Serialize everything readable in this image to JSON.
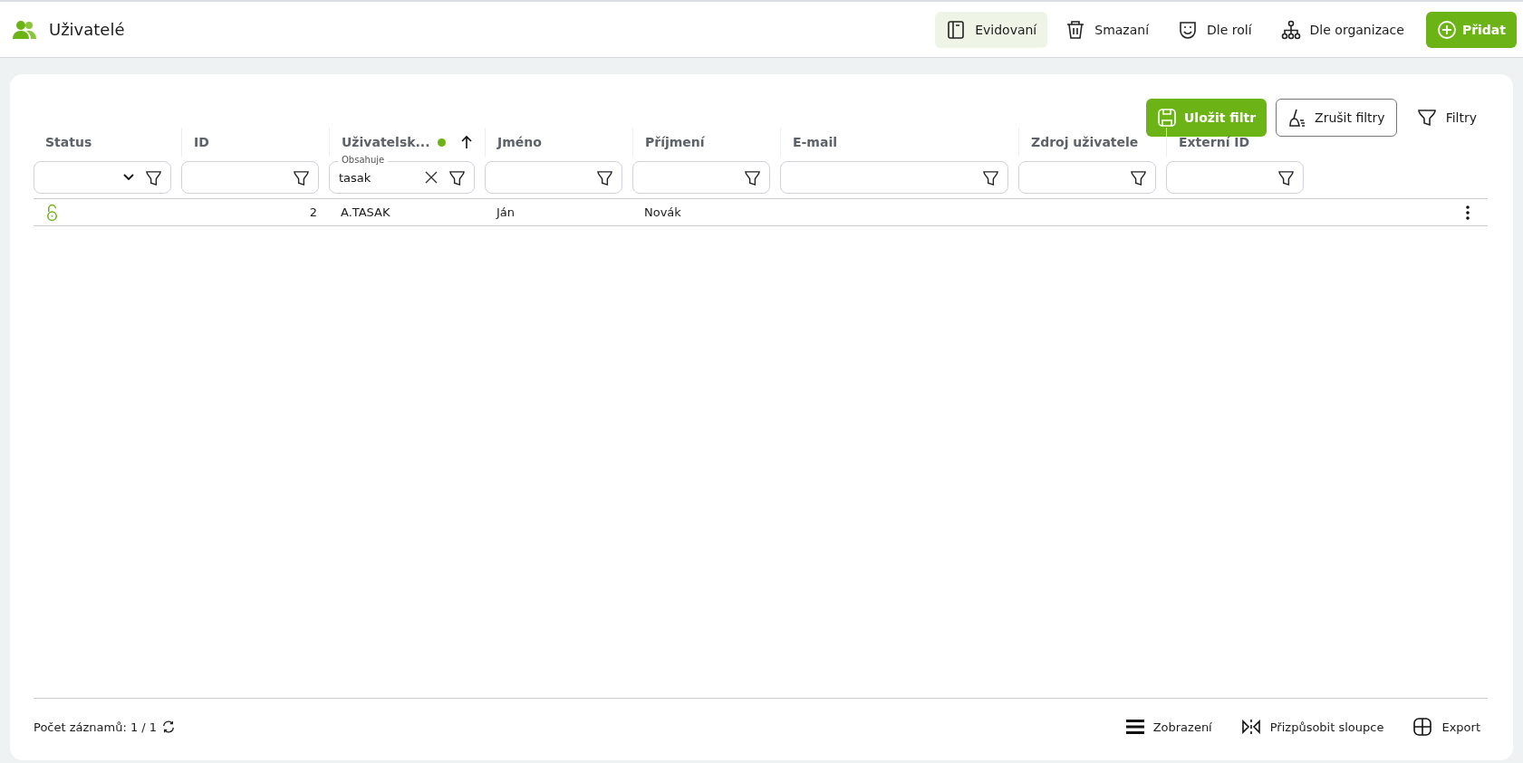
{
  "header": {
    "title": "Uživatelé",
    "views": [
      {
        "label": "Evidovaní",
        "selected": true
      },
      {
        "label": "Smazaní",
        "selected": false
      },
      {
        "label": "Dle rolí",
        "selected": false
      },
      {
        "label": "Dle organizace",
        "selected": false
      }
    ],
    "add_button": "Přidat"
  },
  "toolbar": {
    "save_filter": "Uložit filtr",
    "clear_filters": "Zrušit filtry",
    "filters": "Filtry"
  },
  "table": {
    "columns": [
      {
        "label": "Status",
        "kind": "select",
        "sorted": false,
        "active": false
      },
      {
        "label": "ID",
        "kind": "number",
        "sorted": false,
        "active": false
      },
      {
        "label": "Uživatelsk...",
        "kind": "text",
        "sorted": true,
        "active": true,
        "filter_label": "Obsahuje",
        "filter_value": "tasak"
      },
      {
        "label": "Jméno",
        "kind": "text",
        "sorted": false,
        "active": false
      },
      {
        "label": "Příjmení",
        "kind": "text",
        "sorted": false,
        "active": false
      },
      {
        "label": "E-mail",
        "kind": "text",
        "sorted": false,
        "active": false
      },
      {
        "label": "Zdroj uživatele",
        "kind": "text",
        "sorted": false,
        "active": false
      },
      {
        "label": "Externí ID",
        "kind": "text",
        "sorted": false,
        "active": false
      }
    ],
    "rows": [
      {
        "locked": false,
        "cells": [
          "",
          "2",
          "A.TASAK",
          "Ján",
          "Novák",
          "",
          "",
          ""
        ]
      }
    ]
  },
  "footer": {
    "count": "Počet záznamů: 1 / 1",
    "actions": [
      {
        "label": "Zobrazení"
      },
      {
        "label": "Přizpůsobit sloupce"
      },
      {
        "label": "Export"
      }
    ]
  }
}
